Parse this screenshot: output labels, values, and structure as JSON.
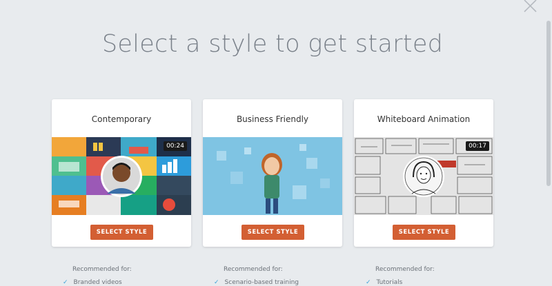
{
  "page": {
    "heading": "Select a style to get started",
    "close_icon": "close-icon"
  },
  "cards": [
    {
      "title": "Contemporary",
      "duration": "00:24",
      "button_label": "SELECT STYLE",
      "recommended_label": "Recommended for:",
      "recommended_items": [
        "Branded videos"
      ]
    },
    {
      "title": "Business Friendly",
      "duration": "",
      "button_label": "SELECT STYLE",
      "recommended_label": "Recommended for:",
      "recommended_items": [
        "Scenario-based training"
      ]
    },
    {
      "title": "Whiteboard Animation",
      "duration": "00:17",
      "button_label": "SELECT STYLE",
      "recommended_label": "Recommended for:",
      "recommended_items": [
        "Tutorials"
      ]
    }
  ],
  "colors": {
    "background": "#e8ebee",
    "accent_button": "#d35f33",
    "check": "#3aa3d9",
    "heading": "#7a818a"
  }
}
